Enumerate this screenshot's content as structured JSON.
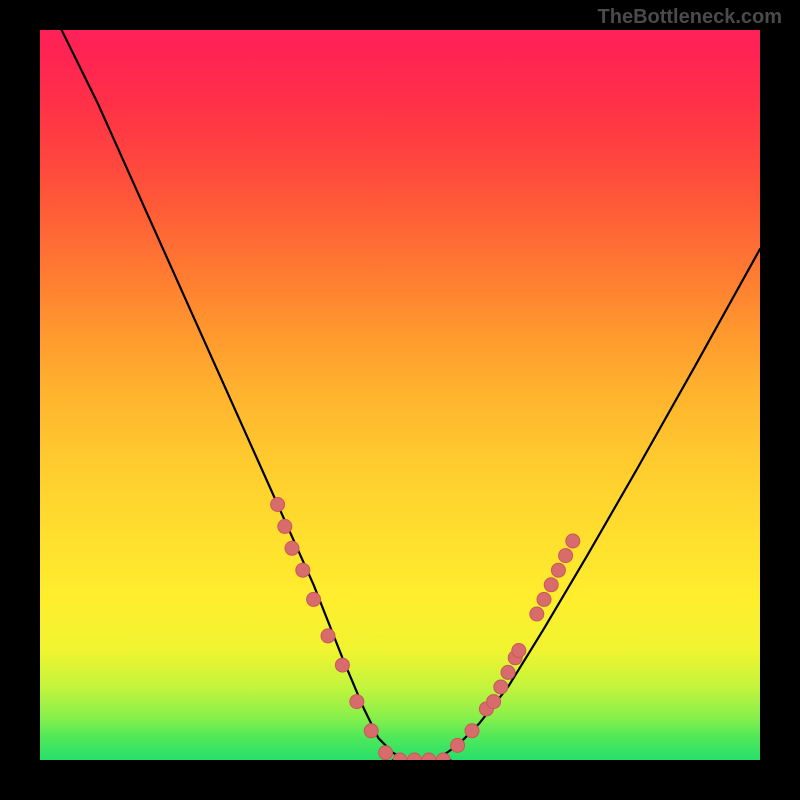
{
  "watermark": "TheBottleneck.com",
  "chart_data": {
    "type": "line",
    "title": "",
    "xlabel": "",
    "ylabel": "",
    "xlim": [
      0,
      100
    ],
    "ylim": [
      0,
      100
    ],
    "background": "rainbow-vertical-gradient",
    "series": [
      {
        "name": "left-curve",
        "x": [
          3,
          8,
          13,
          18,
          23,
          28,
          33,
          38,
          42,
          45,
          47,
          49,
          51
        ],
        "y": [
          100,
          90,
          79,
          68,
          57,
          46,
          35,
          24,
          14,
          7,
          3,
          1,
          0
        ]
      },
      {
        "name": "right-curve",
        "x": [
          55,
          58,
          61,
          65,
          70,
          76,
          83,
          91,
          100
        ],
        "y": [
          0,
          2,
          5,
          10,
          18,
          28,
          40,
          54,
          70
        ]
      },
      {
        "name": "bottom-flat",
        "x": [
          49,
          51,
          53,
          55,
          57
        ],
        "y": [
          0,
          0,
          0,
          0,
          0
        ]
      }
    ],
    "markers": [
      {
        "name": "left-cluster",
        "points": [
          {
            "x": 33,
            "y": 35
          },
          {
            "x": 34,
            "y": 32
          },
          {
            "x": 35,
            "y": 29
          },
          {
            "x": 36.5,
            "y": 26
          },
          {
            "x": 38,
            "y": 22
          },
          {
            "x": 40,
            "y": 17
          },
          {
            "x": 42,
            "y": 13
          },
          {
            "x": 44,
            "y": 8
          },
          {
            "x": 46,
            "y": 4
          },
          {
            "x": 48,
            "y": 1
          },
          {
            "x": 50,
            "y": 0
          },
          {
            "x": 52,
            "y": 0
          },
          {
            "x": 54,
            "y": 0
          },
          {
            "x": 56,
            "y": 0
          }
        ]
      },
      {
        "name": "right-cluster",
        "points": [
          {
            "x": 58,
            "y": 2
          },
          {
            "x": 60,
            "y": 4
          },
          {
            "x": 62,
            "y": 7
          },
          {
            "x": 63,
            "y": 8
          },
          {
            "x": 64,
            "y": 10
          },
          {
            "x": 65,
            "y": 12
          },
          {
            "x": 66,
            "y": 14
          },
          {
            "x": 66.5,
            "y": 15
          },
          {
            "x": 69,
            "y": 20
          },
          {
            "x": 70,
            "y": 22
          },
          {
            "x": 71,
            "y": 24
          },
          {
            "x": 72,
            "y": 26
          },
          {
            "x": 73,
            "y": 28
          },
          {
            "x": 74,
            "y": 30
          }
        ]
      }
    ],
    "marker_style": {
      "fill": "#d86b6b",
      "stroke": "#c95858",
      "r": 7
    }
  }
}
